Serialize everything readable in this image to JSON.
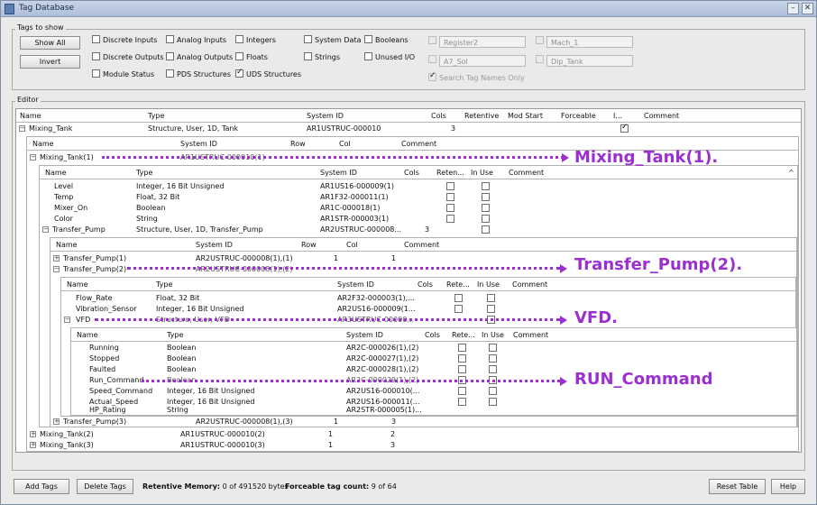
{
  "window": {
    "title": "Tag Database"
  },
  "tags_to_show": {
    "label": "Tags to show",
    "show_all": "Show All",
    "invert": "Invert",
    "checkboxes": [
      {
        "label": "Discrete Inputs",
        "checked": false
      },
      {
        "label": "Analog Inputs",
        "checked": false
      },
      {
        "label": "Integers",
        "checked": false
      },
      {
        "label": "System Data",
        "checked": false
      },
      {
        "label": "Booleans",
        "checked": false
      },
      {
        "label": "Discrete Outputs",
        "checked": false
      },
      {
        "label": "Analog Outputs",
        "checked": false
      },
      {
        "label": "Floats",
        "checked": false
      },
      {
        "label": "Strings",
        "checked": false
      },
      {
        "label": "Unused I/O",
        "checked": false
      },
      {
        "label": "Module Status",
        "checked": false
      },
      {
        "label": "PDS Structures",
        "checked": false
      },
      {
        "label": "UDS Structures",
        "checked": true
      }
    ],
    "filters": [
      {
        "placeholder": "Register2"
      },
      {
        "placeholder": "Mach_1"
      },
      {
        "placeholder": "A7_Sol"
      },
      {
        "placeholder": "Dip_Tank"
      }
    ],
    "search_names": {
      "label": "Search Tag Names Only",
      "checked": true
    }
  },
  "editor": {
    "label": "Editor",
    "columns": [
      "Name",
      "Type",
      "System ID",
      "Cols",
      "Retentive",
      "Mod Start",
      "Forceable",
      "I...",
      "Comment"
    ],
    "top_row": {
      "name": "Mixing_Tank",
      "type": "Structure, User, 1D, Tank",
      "system_id": "AR1USTRUC-000010",
      "cols": "3"
    },
    "lvl1_columns": [
      "Name",
      "System ID",
      "Row",
      "Col",
      "Comment"
    ],
    "lvl1_rows": [
      {
        "name": "Mixing_Tank(1)",
        "system_id": "AR1USTRUC-000010(1)",
        "row": "",
        "col": ""
      },
      {
        "name": "Mixing_Tank(2)",
        "system_id": "AR1USTRUC-000010(2)",
        "row": "1",
        "col": "2"
      },
      {
        "name": "Mixing_Tank(3)",
        "system_id": "AR1USTRUC-000010(3)",
        "row": "1",
        "col": "3"
      }
    ],
    "lvl2_columns": [
      "Name",
      "Type",
      "System ID",
      "Cols",
      "Reten...",
      "In Use",
      "Comment"
    ],
    "lvl2_rows": [
      {
        "name": "Level",
        "type": "Integer, 16 Bit Unsigned",
        "system_id": "AR1US16-000009(1)",
        "cols": ""
      },
      {
        "name": "Temp",
        "type": "Float, 32 Bit",
        "system_id": "AR1F32-000011(1)",
        "cols": ""
      },
      {
        "name": "Mixer_On",
        "type": "Boolean",
        "system_id": "AR1C-000018(1)",
        "cols": ""
      },
      {
        "name": "Color",
        "type": "String",
        "system_id": "AR1STR-000003(1)",
        "cols": ""
      },
      {
        "name": "Transfer_Pump",
        "type": "Structure, User, 1D, Transfer_Pump",
        "system_id": "AR2USTRUC-000008...",
        "cols": "3"
      }
    ],
    "lvl3_columns": [
      "Name",
      "System ID",
      "Row",
      "Col",
      "Comment"
    ],
    "lvl3_rows": [
      {
        "name": "Transfer_Pump(1)",
        "system_id": "AR2USTRUC-000008(1),(1)",
        "row": "1",
        "col": "1"
      },
      {
        "name": "Transfer_Pump(2)",
        "system_id": "AR2USTRUC-000008(1),(2)",
        "row": "",
        "": ""
      },
      {
        "name": "Transfer_Pump(3)",
        "system_id": "AR2USTRUC-000008(1),(3)",
        "row": "1",
        "col": "3"
      }
    ],
    "lvl4_columns": [
      "Name",
      "Type",
      "System ID",
      "Cols",
      "Rete...",
      "In Use",
      "Comment"
    ],
    "lvl4_rows": [
      {
        "name": "Flow_Rate",
        "type": "Float, 32 Bit",
        "system_id": "AR2F32-000003(1),..."
      },
      {
        "name": "Vibration_Sensor",
        "type": "Integer, 16 Bit Unsigned",
        "system_id": "AR2US16-000009(1..."
      },
      {
        "name": "VFD",
        "type": "Structure, User, VFD",
        "system_id": "AR3USTRUC-00000..."
      }
    ],
    "lvl5_columns": [
      "Name",
      "Type",
      "System ID",
      "Cols",
      "Rete...",
      "In Use",
      "Comment"
    ],
    "lvl5_rows": [
      {
        "name": "Running",
        "type": "Boolean",
        "system_id": "AR2C-000026(1),(2)"
      },
      {
        "name": "Stopped",
        "type": "Boolean",
        "system_id": "AR2C-000027(1),(2)"
      },
      {
        "name": "Faulted",
        "type": "Boolean",
        "system_id": "AR2C-000028(1),(2)"
      },
      {
        "name": "Run_Command",
        "type": "Boolean",
        "system_id": "AR2C-000029(1),(2)"
      },
      {
        "name": "Speed_Command",
        "type": "Integer, 16 Bit Unsigned",
        "system_id": "AR2US16-000010(..."
      },
      {
        "name": "Actual_Speed",
        "type": "Integer, 16 Bit Unsigned",
        "system_id": "AR2US16-000011(..."
      },
      {
        "name": "HP_Rating",
        "type": "String",
        "system_id": "AR2STR-000005(1)..."
      }
    ]
  },
  "annotations": [
    "Mixing_Tank(1).",
    "Transfer_Pump(2).",
    "VFD.",
    "RUN_Command"
  ],
  "footer": {
    "add_tags": "Add Tags",
    "delete_tags": "Delete Tags",
    "retentive_label": "Retentive Memory:",
    "retentive_value": "0 of 491520 bytes",
    "forceable_label": "Forceable tag count:",
    "forceable_value": "9 of 64",
    "reset_table": "Reset Table",
    "help": "Help"
  },
  "colors": {
    "accent": "#9b2fcf",
    "header": "#aebfd8"
  }
}
